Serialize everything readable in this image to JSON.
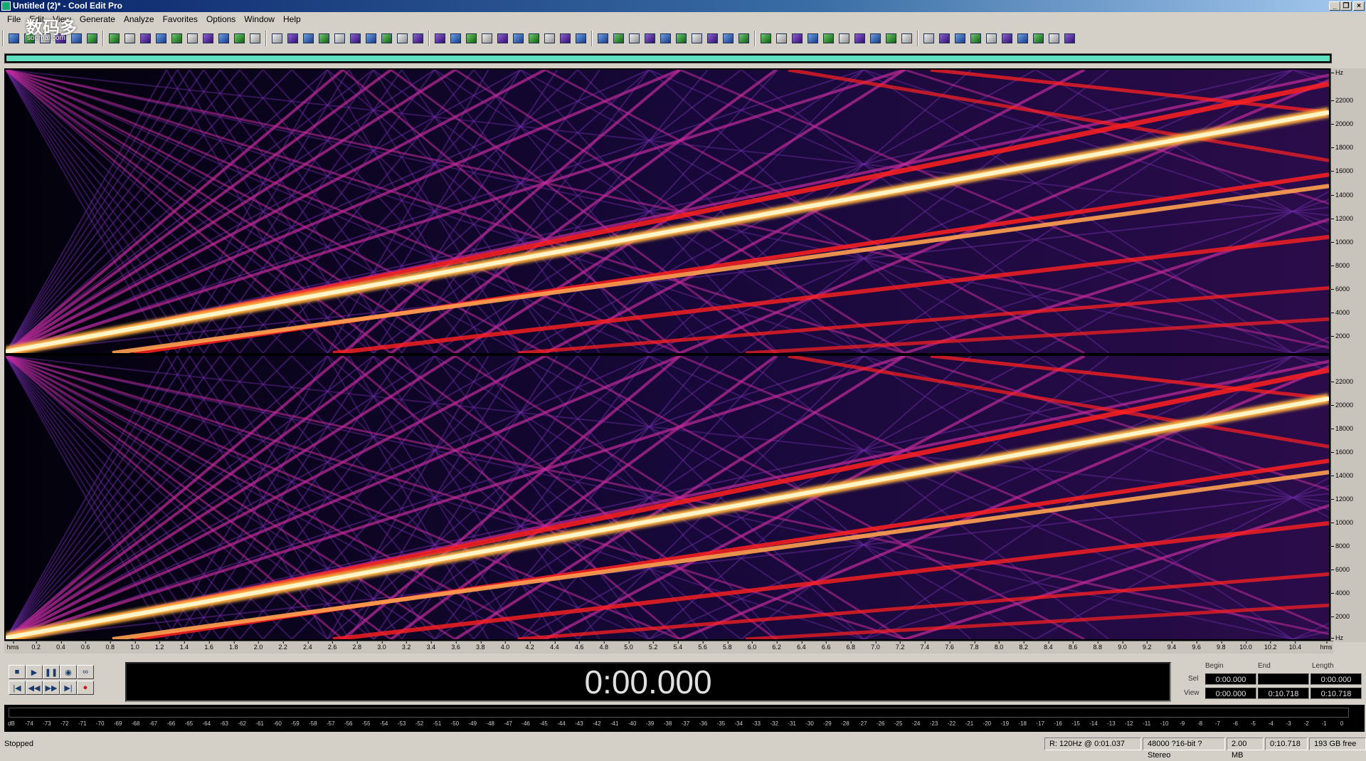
{
  "window": {
    "title": "Untitled (2)* - Cool Edit Pro"
  },
  "menus": [
    "File",
    "Edit",
    "View",
    "Generate",
    "Analyze",
    "Favorites",
    "Options",
    "Window",
    "Help"
  ],
  "watermark": {
    "main": "数码多",
    "sub": "soomal.com"
  },
  "toolbar_icons": [
    "open-icon",
    "save-icon",
    "undo-icon",
    "redo-icon",
    "cut-icon",
    "copy-icon",
    "paste-icon",
    "mix-paste-icon",
    "waveform-view-icon",
    "spectral-view-icon",
    "zoom-in-icon",
    "zoom-out-icon",
    "zoom-full-icon",
    "help-icon",
    "cue-list-icon",
    "play-list-icon",
    "effects-icon",
    "filter-icon",
    "noise-reduction-icon",
    "amplify-icon",
    "delay-icon",
    "reverb-icon",
    "eq-icon",
    "pitch-icon",
    "analysis-icon"
  ],
  "spectral": {
    "freq_labels_hz": [
      "Hz",
      "22000",
      "20000",
      "18000",
      "16000",
      "14000",
      "12000",
      "10000",
      "8000",
      "6000",
      "4000",
      "2000"
    ],
    "freq_labels_ch2": [
      "22000",
      "20000",
      "18000",
      "16000",
      "14000",
      "12000",
      "10000",
      "8000",
      "6000",
      "4000",
      "2000",
      "Hz"
    ],
    "time_labels": [
      "hms",
      "0.2",
      "0.4",
      "0.6",
      "0.8",
      "1.0",
      "1.2",
      "1.4",
      "1.6",
      "1.8",
      "2.0",
      "2.2",
      "2.4",
      "2.6",
      "2.8",
      "3.0",
      "3.2",
      "3.4",
      "3.6",
      "3.8",
      "4.0",
      "4.2",
      "4.4",
      "4.6",
      "4.8",
      "5.0",
      "5.2",
      "5.4",
      "5.6",
      "5.8",
      "6.0",
      "6.2",
      "6.4",
      "6.6",
      "6.8",
      "7.0",
      "7.2",
      "7.4",
      "7.6",
      "7.8",
      "8.0",
      "8.2",
      "8.4",
      "8.6",
      "8.8",
      "9.0",
      "9.2",
      "9.4",
      "9.6",
      "9.8",
      "10.0",
      "10.2",
      "10.4",
      "hms"
    ],
    "colors": {
      "background": "#0a0420",
      "hot": "#fff4c8",
      "red": "#ff2020",
      "magenta": "#c02a9a",
      "purple": "#6a2aa0"
    }
  },
  "transport": {
    "buttons": [
      "stop",
      "play",
      "pause",
      "play-to-end",
      "loop",
      "go-to-start",
      "rewind",
      "fast-forward",
      "go-to-end",
      "record"
    ]
  },
  "time_display": "0:00.000",
  "selection": {
    "headers": {
      "begin": "Begin",
      "end": "End",
      "length": "Length"
    },
    "sel_label": "Sel",
    "view_label": "View",
    "sel": {
      "begin": "0:00.000",
      "end": "",
      "length": "0:00.000"
    },
    "view": {
      "begin": "0:00.000",
      "end": "0:10.718",
      "length": "0:10.718"
    }
  },
  "level_meter": {
    "db_labels": [
      "dB",
      "-74",
      "-73",
      "-72",
      "-71",
      "-70",
      "-69",
      "-68",
      "-67",
      "-66",
      "-65",
      "-64",
      "-63",
      "-62",
      "-61",
      "-60",
      "-59",
      "-58",
      "-57",
      "-56",
      "-55",
      "-54",
      "-53",
      "-52",
      "-51",
      "-50",
      "-49",
      "-48",
      "-47",
      "-46",
      "-45",
      "-44",
      "-43",
      "-42",
      "-41",
      "-40",
      "-39",
      "-38",
      "-37",
      "-36",
      "-35",
      "-34",
      "-33",
      "-32",
      "-31",
      "-30",
      "-29",
      "-28",
      "-27",
      "-26",
      "-25",
      "-24",
      "-23",
      "-22",
      "-21",
      "-20",
      "-19",
      "-18",
      "-17",
      "-16",
      "-15",
      "-14",
      "-13",
      "-12",
      "-11",
      "-10",
      "-9",
      "-8",
      "-7",
      "-6",
      "-5",
      "-4",
      "-3",
      "-2",
      "-1",
      "0"
    ]
  },
  "status": {
    "state": "Stopped",
    "cursor": "R: 120Hz @   0:01.037",
    "format": "48000 ?16-bit ?Stereo",
    "file_size": "2.00 MB",
    "duration": "0:10.718",
    "free_space": "193 GB free"
  }
}
